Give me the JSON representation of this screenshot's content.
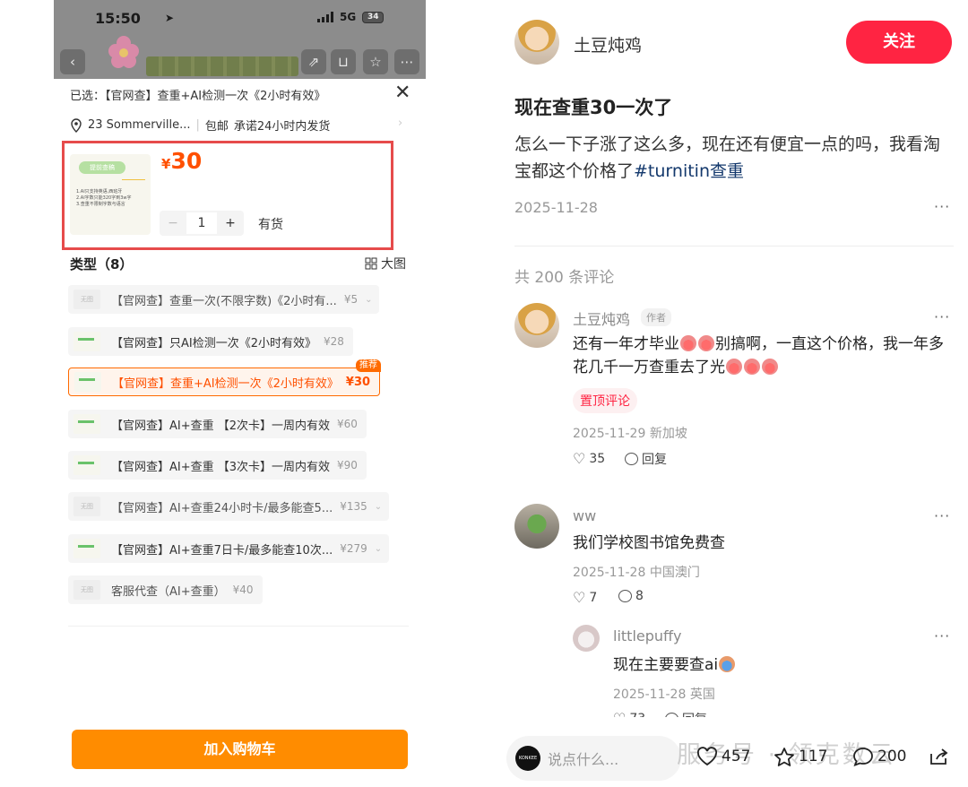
{
  "left": {
    "status": {
      "time": "15:50",
      "network": "5G",
      "battery": "34"
    },
    "selected": {
      "label": "已选：",
      "value": "【官网查】查重+AI检测一次《2小时有效》"
    },
    "address": {
      "text": "23 Sommerville...",
      "shipping": "包邮",
      "promise": "承诺24小时内发货"
    },
    "product": {
      "price_symbol": "¥",
      "price": "30",
      "thumb_title": "提前查稿",
      "thumb_lines": [
        "1.AI只支持英语,西班牙",
        "2.AI字数只能320字到3w字",
        "3.查重不限制字数与语言"
      ],
      "qty": "1",
      "minus": "−",
      "plus": "+",
      "stock": "有货"
    },
    "type_header": "类型（8）",
    "big_image": "大图",
    "options": [
      {
        "thumb": "无图",
        "label": "【官网查】查重一次(不限字数)《2小时有...",
        "price": "¥5",
        "chevron": true,
        "state": "disabled"
      },
      {
        "thumb": "",
        "label": "【官网查】只AI检测一次《2小时有效》",
        "price": "¥28",
        "chevron": false,
        "state": "normal"
      },
      {
        "thumb": "",
        "label": "【官网查】查重+AI检测一次《2小时有效》",
        "price": "¥30",
        "chevron": false,
        "state": "selected",
        "badge": "推荐"
      },
      {
        "thumb": "",
        "label": "【官网查】AI+查重 【2次卡】一周内有效",
        "price": "¥60",
        "chevron": false,
        "state": "normal"
      },
      {
        "thumb": "",
        "label": "【官网查】AI+查重 【3次卡】一周内有效",
        "price": "¥90",
        "chevron": false,
        "state": "normal"
      },
      {
        "thumb": "无图",
        "label": "【官网查】AI+查重24小时卡/最多能查5...",
        "price": "¥135",
        "chevron": true,
        "state": "disabled"
      },
      {
        "thumb": "",
        "label": "【官网查】AI+查重7日卡/最多能查10次...",
        "price": "¥279",
        "chevron": true,
        "state": "normal"
      },
      {
        "thumb": "无图",
        "label": "客服代查（AI+查重）",
        "price": "¥40",
        "chevron": false,
        "state": "disabled"
      }
    ],
    "cart_button": "加入购物车"
  },
  "right": {
    "author": "土豆炖鸡",
    "follow": "关注",
    "post_title": "现在查重30一次了",
    "post_body": "怎么一下子涨了这么多，现在还有便宜一点的吗，我看淘宝都这个价格了",
    "post_tag": "#turnitin查重",
    "post_date": "2025-11-28",
    "comment_count": "共 200 条评论",
    "comments": [
      {
        "name": "土豆炖鸡",
        "badge": "作者",
        "text_a": "还有一年才毕业",
        "text_b": "别搞啊，一直这个价格，我一年多花几千一万查重去了光",
        "pinned": "置顶评论",
        "date": "2025-11-29",
        "location": "新加坡",
        "likes": "35",
        "reply": "回复"
      },
      {
        "name": "ww",
        "text": "我们学校图书馆免费查",
        "date": "2025-11-28",
        "location": "中国澳门",
        "likes": "7",
        "replies": "8"
      },
      {
        "name": "littlepuffy",
        "text": "现在主要要查ai",
        "date": "2025-11-28",
        "location": "英国",
        "likes": "73",
        "reply": "回复"
      }
    ],
    "bottom": {
      "placeholder": "说点什么...",
      "likes": "457",
      "stars": "117",
      "comments": "200",
      "avatar_text": "KONKEE"
    },
    "watermark": "服务号 · 领克数云"
  },
  "colors": {
    "accent_red": "#ff2442",
    "taobao_orange": "#ff5000",
    "cart_orange": "#ff8c00",
    "highlight_box": "#e64b4b",
    "tag_blue": "#13386c"
  }
}
